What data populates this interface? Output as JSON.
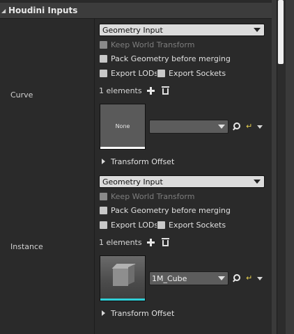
{
  "header": {
    "title": "Houdini Inputs",
    "collapse_icon": "triangle-down-icon"
  },
  "inputs": [
    {
      "label": "Curve",
      "input_type": "Geometry Input",
      "keep_world_transform": "Keep World Transform",
      "pack_geometry": "Pack Geometry before merging",
      "export_lods": "Export LODs",
      "export_sockets": "Export Sockets",
      "elements": "1 elements",
      "thumbnail_text": "None",
      "thumbnail_bar_color": "#ffffff",
      "asset_value": "",
      "transform_offset": "Transform Offset"
    },
    {
      "label": "Instance",
      "input_type": "Geometry Input",
      "keep_world_transform": "Keep World Transform",
      "pack_geometry": "Pack Geometry before merging",
      "export_lods": "Export LODs",
      "export_sockets": "Export Sockets",
      "elements": "1 elements",
      "thumbnail_bar_color": "#2fd0d8",
      "asset_value": "1M_Cube",
      "transform_offset": "Transform Offset"
    }
  ],
  "colors": {
    "panel_bg": "#2a2a2a",
    "header_bg": "#3c3c3c",
    "reset_icon": "#e6d050"
  }
}
